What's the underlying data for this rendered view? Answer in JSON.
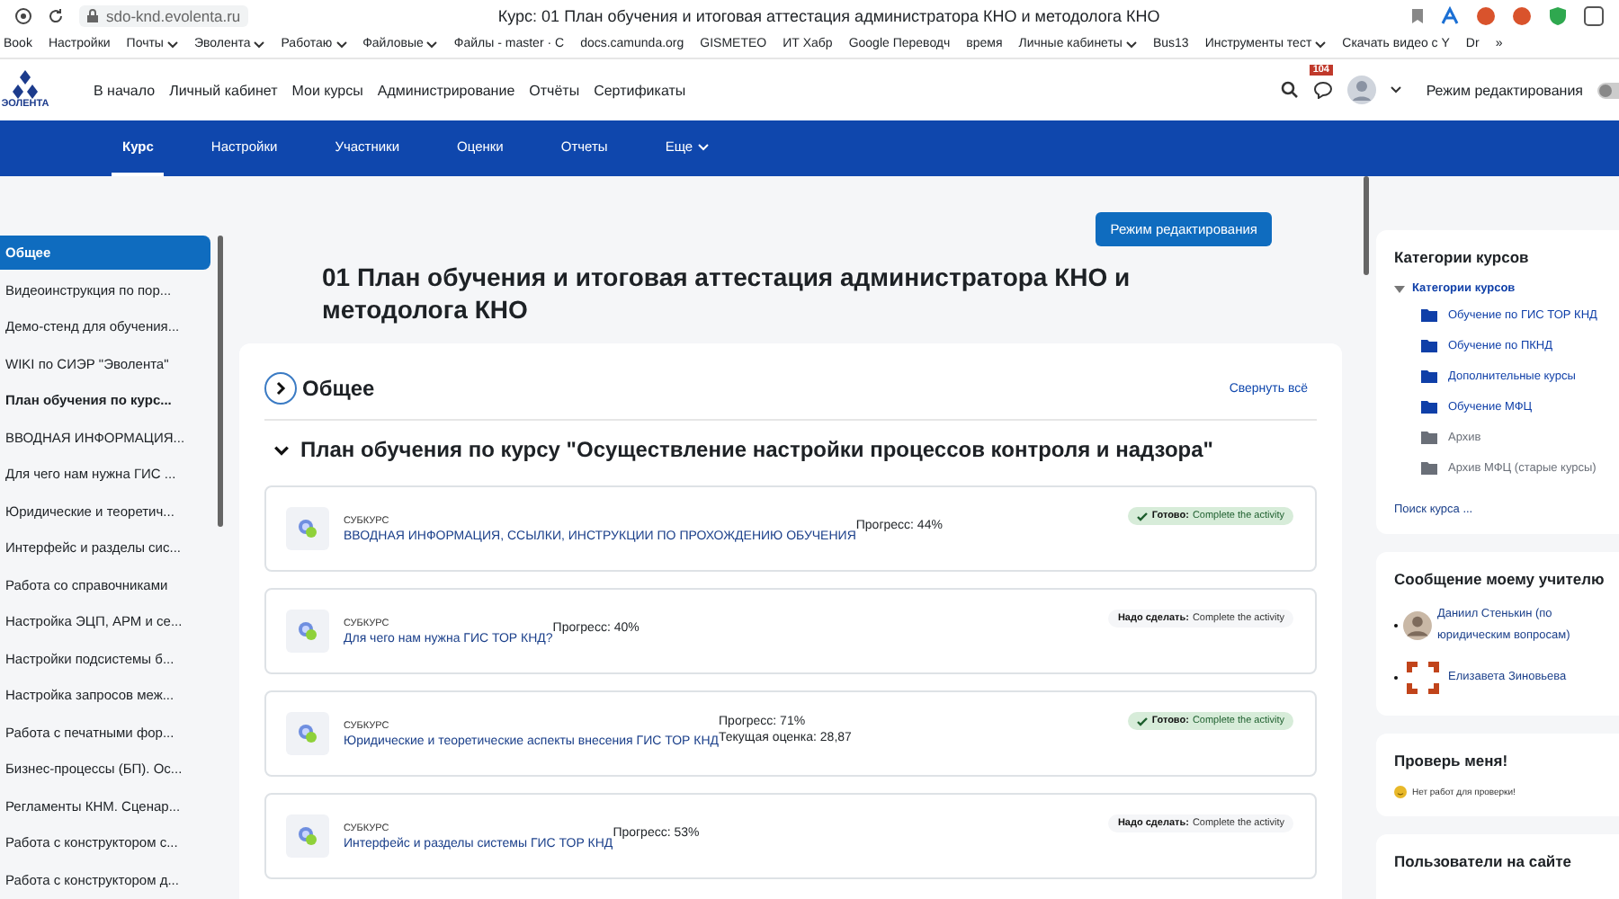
{
  "browser": {
    "url": "sdo-knd.evolenta.ru",
    "title": "Курс: 01 План обучения и итоговая аттестация администратора КНО и методолога КНО",
    "bookmarks": [
      {
        "label": "Book",
        "dropdown": false
      },
      {
        "label": "Настройки",
        "dropdown": false
      },
      {
        "label": "Почты",
        "dropdown": true
      },
      {
        "label": "Эволента",
        "dropdown": true
      },
      {
        "label": "Работаю",
        "dropdown": true
      },
      {
        "label": "Файловые",
        "dropdown": true
      },
      {
        "label": "Файлы - master · C",
        "dropdown": false
      },
      {
        "label": "docs.camunda.org",
        "dropdown": false
      },
      {
        "label": "GISMETEO",
        "dropdown": false
      },
      {
        "label": "ИТ Хабр",
        "dropdown": false
      },
      {
        "label": "Google Переводч",
        "dropdown": false
      },
      {
        "label": "время",
        "dropdown": false
      },
      {
        "label": "Личные кабинеты",
        "dropdown": true
      },
      {
        "label": "Bus13",
        "dropdown": false
      },
      {
        "label": "Инструменты тест",
        "dropdown": true
      },
      {
        "label": "Скачать видео с Y",
        "dropdown": false
      },
      {
        "label": "Dr",
        "dropdown": false
      },
      {
        "label": "»",
        "dropdown": false
      }
    ]
  },
  "site_nav": {
    "logo_text": "ЭОЛЕНТА",
    "items": [
      "В начало",
      "Личный кабинет",
      "Мои курсы",
      "Администрирование",
      "Отчёты",
      "Сертификаты"
    ],
    "notifications_count": "104",
    "edit_mode_label": "Режим редактирования",
    "edit_mode_on": false
  },
  "course_nav": {
    "tabs": [
      {
        "label": "Курс",
        "selected": true,
        "dropdown": false
      },
      {
        "label": "Настройки",
        "selected": false,
        "dropdown": false
      },
      {
        "label": "Участники",
        "selected": false,
        "dropdown": false
      },
      {
        "label": "Оценки",
        "selected": false,
        "dropdown": false
      },
      {
        "label": "Отчеты",
        "selected": false,
        "dropdown": false
      },
      {
        "label": "Еще",
        "selected": false,
        "dropdown": true
      }
    ]
  },
  "sidebar": {
    "items": [
      {
        "label": "Общее",
        "selected": true,
        "bold": true
      },
      {
        "label": "Видеоинструкция по пор...",
        "selected": false,
        "bold": false
      },
      {
        "label": "Демо-стенд для обучения...",
        "selected": false,
        "bold": false
      },
      {
        "label": "WIKI по СИЭР \"Эволента\"",
        "selected": false,
        "bold": false
      },
      {
        "label": "План обучения по курс...",
        "selected": false,
        "bold": true
      },
      {
        "label": "ВВОДНАЯ ИНФОРМАЦИЯ...",
        "selected": false,
        "bold": false
      },
      {
        "label": "Для чего нам нужна ГИС ...",
        "selected": false,
        "bold": false
      },
      {
        "label": "Юридические и теоретич...",
        "selected": false,
        "bold": false
      },
      {
        "label": "Интерфейс и разделы сис...",
        "selected": false,
        "bold": false
      },
      {
        "label": "Работа со справочниками",
        "selected": false,
        "bold": false
      },
      {
        "label": "Настройка ЭЦП, АРМ и се...",
        "selected": false,
        "bold": false
      },
      {
        "label": "Настройки подсистемы б...",
        "selected": false,
        "bold": false
      },
      {
        "label": "Настройка запросов меж...",
        "selected": false,
        "bold": false
      },
      {
        "label": "Работа с печатными фор...",
        "selected": false,
        "bold": false
      },
      {
        "label": "Бизнес-процессы (БП). Ос...",
        "selected": false,
        "bold": false
      },
      {
        "label": "Регламенты КНМ. Сценар...",
        "selected": false,
        "bold": false
      },
      {
        "label": "Работа с конструктором с...",
        "selected": false,
        "bold": false
      },
      {
        "label": "Работа с конструктором д...",
        "selected": false,
        "bold": false
      }
    ]
  },
  "main": {
    "edit_button": "Режим редактирования",
    "title": "01 План обучения и итоговая аттестация администратора КНО и методолога КНО",
    "section": {
      "title": "Общее",
      "expanded": false,
      "collapse_all": "Свернуть всё"
    },
    "subsection": {
      "title": "План обучения по курсу \"Осуществление настройки процессов контроля и надзора\"",
      "expanded": true
    },
    "activities": [
      {
        "type_label": "СУБКУРС",
        "name": "ВВОДНАЯ ИНФОРМАЦИЯ, ССЫЛКИ, ИНСТРУКЦИИ ПО ПРОХОЖДЕНИЮ ОБУЧЕНИЯ",
        "progress": "Прогресс: 44%",
        "status": {
          "kind": "done",
          "label": "Готово:",
          "text": "Complete the activity"
        }
      },
      {
        "type_label": "СУБКУРС",
        "name": "Для чего нам нужна ГИС ТОР КНД?",
        "progress": "Прогресс: 40%",
        "status": {
          "kind": "todo",
          "label": "Надо сделать:",
          "text": "Complete the activity"
        }
      },
      {
        "type_label": "СУБКУРС",
        "name": "Юридические и теоретические аспекты внесения ГИС ТОР КНД",
        "progress": "Прогресс: 71%",
        "grade": "Текущая оценка: 28,87",
        "status": {
          "kind": "done",
          "label": "Готово:",
          "text": "Complete the activity"
        }
      },
      {
        "type_label": "СУБКУРС",
        "name": "Интерфейс и разделы системы ГИС ТОР КНД",
        "progress": "Прогресс: 53%",
        "status": {
          "kind": "todo",
          "label": "Надо сделать:",
          "text": "Complete the activity"
        }
      }
    ]
  },
  "right": {
    "categories": {
      "title": "Категории курсов",
      "root": {
        "label": "Категории курсов",
        "expanded": true,
        "children": [
          {
            "label": "Обучение по ГИС ТОР КНД",
            "hidden": false
          },
          {
            "label": "Обучение по ПКНД",
            "hidden": false
          },
          {
            "label": "Дополнительные курсы",
            "hidden": false
          },
          {
            "label": "Обучение МФЦ",
            "hidden": false
          },
          {
            "label": "Архив",
            "hidden": true
          },
          {
            "label": "Архив МФЦ (старые курсы)",
            "hidden": true
          }
        ]
      },
      "search_link": "Поиск курса ..."
    },
    "message_teacher": {
      "title": "Сообщение моему учителю",
      "teachers": [
        {
          "name": "Даниил Стенькин (по юридическим вопросам)",
          "kind": "photo"
        },
        {
          "name": "Елизавета Зиновьева",
          "kind": "logo"
        }
      ]
    },
    "check": {
      "title": "Проверь меня!",
      "message": "Нет работ для проверки!"
    },
    "online": {
      "title": "Пользователи на сайте"
    }
  }
}
